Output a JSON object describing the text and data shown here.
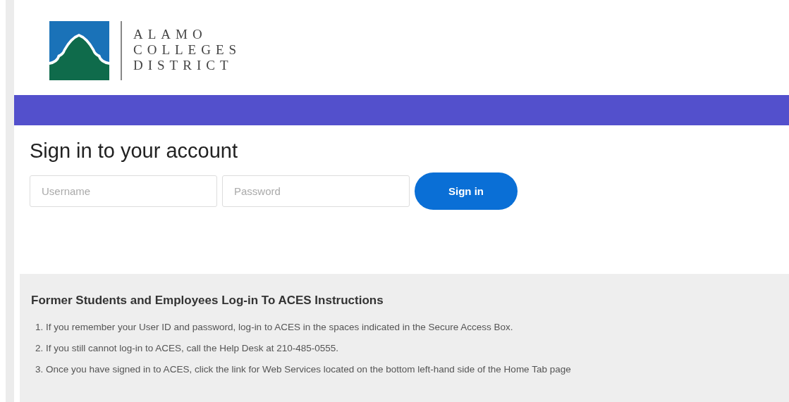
{
  "logo": {
    "lines": [
      "ALAMO",
      "COLLEGES",
      "DISTRICT"
    ]
  },
  "sign_in": {
    "title": "Sign in to your account",
    "username": {
      "placeholder": "Username"
    },
    "password": {
      "placeholder": "Password"
    },
    "button": "Sign in"
  },
  "instructions": {
    "title": "Former Students and Employees Log-in To ACES Instructions",
    "items": [
      "1. If you remember your User ID and password, log-in to ACES in the spaces indicated in the Secure Access Box.",
      "2. If you still cannot log-in to ACES, call the Help Desk at 210-485-0555.",
      "3. Once you have signed in to ACES, click the link for Web Services located on the bottom left-hand side of the Home Tab page"
    ]
  }
}
